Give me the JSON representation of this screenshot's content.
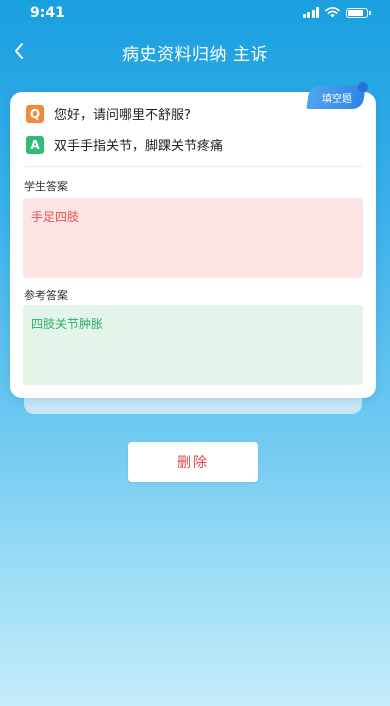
{
  "status_bar": {
    "time": "9:41"
  },
  "nav": {
    "title": "病史资料归纳 主诉"
  },
  "card": {
    "tag": "填空题",
    "question_badge": "Q",
    "question": "您好，请问哪里不舒服?",
    "answer_badge": "A",
    "answer": "双手手指关节，脚踝关节疼痛",
    "student_label": "学生答案",
    "student_answer": "手足四肢",
    "reference_label": "参考答案",
    "reference_answer": "四肢关节肿胀"
  },
  "actions": {
    "delete_label": "删除"
  },
  "colors": {
    "header_blue": "#1a9fe0",
    "question_orange": "#f08a3c",
    "answer_green": "#2fbb78",
    "student_red": "#e45353",
    "reference_green": "#2fae6a",
    "delete_red": "#e0474c"
  },
  "icons": {
    "back": "chevron-left-icon",
    "signal": "cellular-signal-icon",
    "wifi": "wifi-icon",
    "battery": "battery-icon"
  }
}
